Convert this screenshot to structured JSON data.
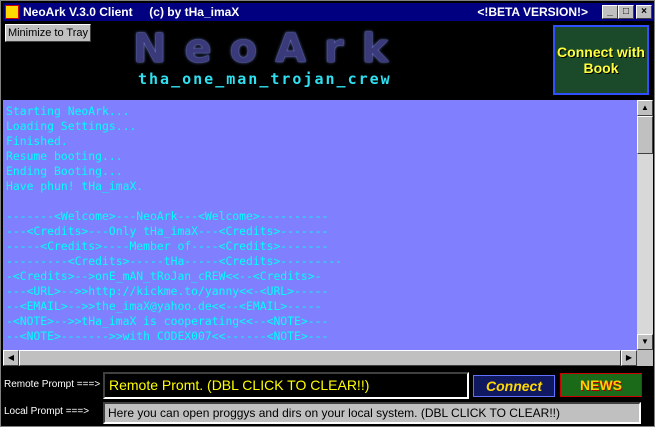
{
  "window": {
    "title": "NeoArk V.3.0 Client     (c) by tHa_imaX",
    "beta": "<!BETA VERSION!>",
    "minimize_glyph": "_",
    "maximize_glyph": "□",
    "close_glyph": "×"
  },
  "toolbar": {
    "minimize_to_tray": "Minimize to Tray"
  },
  "banner": {
    "logo_text": "NeoArk",
    "subtitle": "tha_one_man_trojan_crew",
    "connect_book": "Connect with Book"
  },
  "console": {
    "lines": "Starting NeoArk...\nLoading Settings...\nFinished.\nResume booting...\nEnding Booting...\nHave phun! tHa_imaX.\n\n-------<Welcome>---NeoArk---<Welcome>----------\n---<Credits>---Only tHa_imaX---<Credits>-------\n-----<Credits>----Member of----<Credits>-------\n---------<Credits>-----tHa-----<Credits>---------\n-<Credits>-->onE_mAN_tRoJan_cREW<<--<Credits>-\n---<URL>-->>http://kickme.to/yanny<<-<URL>-----\n--<EMAIL>-->>the_imaX@yahoo.de<<--<EMAIL>-----\n-<NOTE>-->>tHa_imaX is cooperating<<--<NOTE>---\n--<NOTE>------->>with CODEX007<<------<NOTE>---"
  },
  "prompts": {
    "remote_label": "Remote Prompt ===>",
    "remote_value": "Remote Promt. (DBL CLICK TO CLEAR!!)",
    "local_label": "Local Prompt ===>",
    "local_value": "Here you can open proggys and dirs on your local system.  (DBL CLICK TO CLEAR!!)"
  },
  "buttons": {
    "connect": "Connect",
    "second": "NEWS"
  },
  "colors": {
    "titlebar": "#000080",
    "console_bg": "#8080ff",
    "console_text": "#00ffff",
    "remote_text": "#ffff00"
  }
}
